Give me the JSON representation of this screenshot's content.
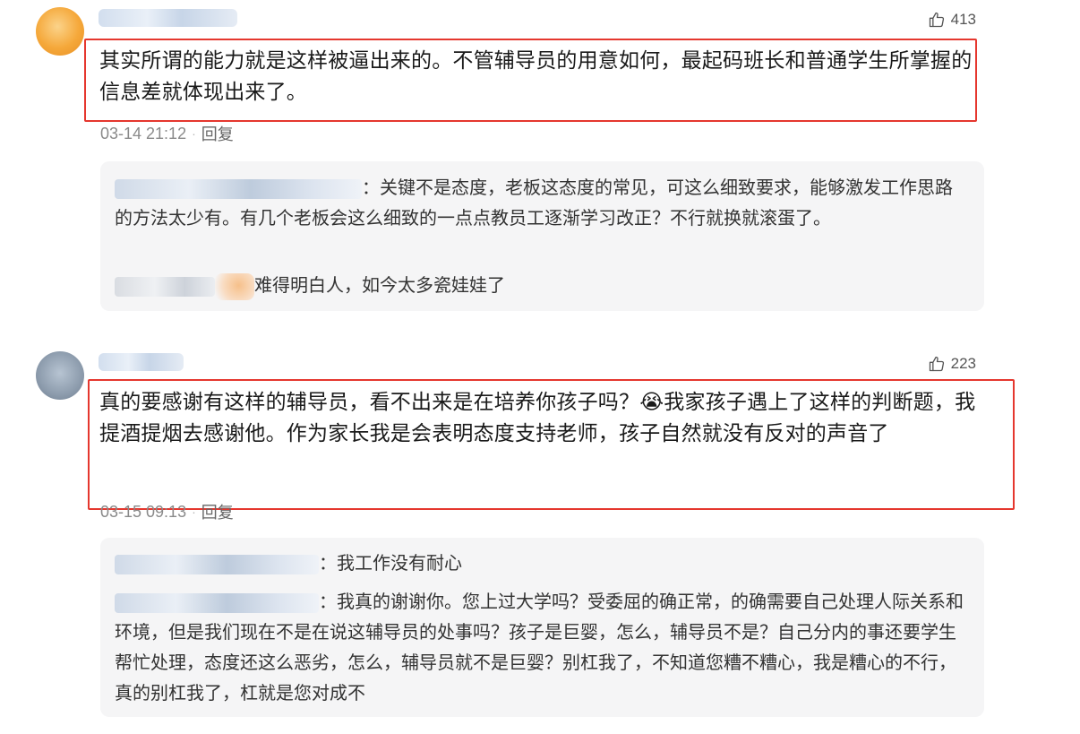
{
  "comments": [
    {
      "likes": "413",
      "text": "其实所谓的能力就是这样被逼出来的。不管辅导员的用意如何，最起码班长和普通学生所掌握的信息差就体现出来了。",
      "date": "03-14 21:12",
      "reply_label": "回复",
      "replies": [
        {
          "sep": "：",
          "text": "关键不是态度，老板这态度的常见，可这么细致要求，能够激发工作思路的方法太少有。有几个老板会这么细致的一点点教员工逐渐学习改正？不行就换就滚蛋了。"
        },
        {
          "sep": "",
          "text": "难得明白人，如今太多瓷娃娃了"
        }
      ]
    },
    {
      "likes": "223",
      "text_a": "真的要感谢有这样的辅导员，看不出来是在培养你孩子吗？",
      "emoji": "😭",
      "text_b": "我家孩子遇上了这样的判断题，我提酒提烟去感谢他。作为家长我是会表明态度支持老师，孩子自然就没有反对的声音了",
      "date": "03-15 09:13",
      "reply_label": "回复",
      "replies": [
        {
          "sep": "：",
          "text": "我工作没有耐心"
        },
        {
          "sep": "：",
          "text": "我真的谢谢你。您上过大学吗？受委屈的确正常，的确需要自己处理人际关系和环境，但是我们现在不是在说这辅导员的处事吗？孩子是巨婴，怎么，辅导员不是？自己分内的事还要学生帮忙处理，态度还这么恶劣，怎么，辅导员就不是巨婴？别杠我了，不知道您糟不糟心，我是糟心的不行，真的别杠我了，杠就是您对成不"
        }
      ]
    }
  ],
  "colors": {
    "highlight": "#e5372e",
    "reply_bg": "#f5f5f6",
    "meta": "#8a8a8a"
  },
  "icons": {
    "like": "thumbs-up-icon"
  }
}
